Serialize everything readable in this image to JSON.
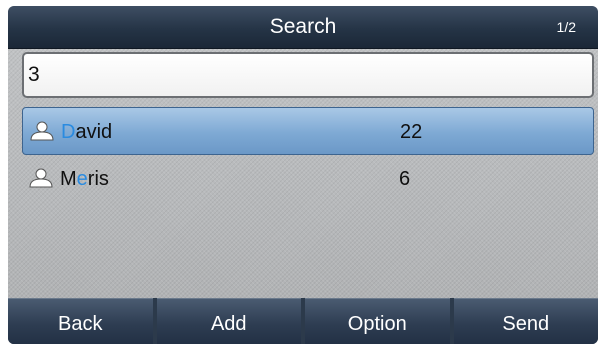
{
  "header": {
    "title": "Search",
    "page_indicator": "1/2"
  },
  "search": {
    "value": "3"
  },
  "contacts": [
    {
      "name_first": "D",
      "name_highlight": "",
      "name_rest": "avid",
      "number": "22",
      "selected": true,
      "icon": "person-icon"
    },
    {
      "name_first": "M",
      "name_highlight": "e",
      "name_rest": "ris",
      "number": "6",
      "selected": false,
      "icon": "person-icon"
    }
  ],
  "softkeys": {
    "back": "Back",
    "add": "Add",
    "option": "Option",
    "send": "Send"
  },
  "colors": {
    "highlight_text": "#2a8be0",
    "selected_row": "#7ea9d4",
    "titlebar": "#253446"
  }
}
